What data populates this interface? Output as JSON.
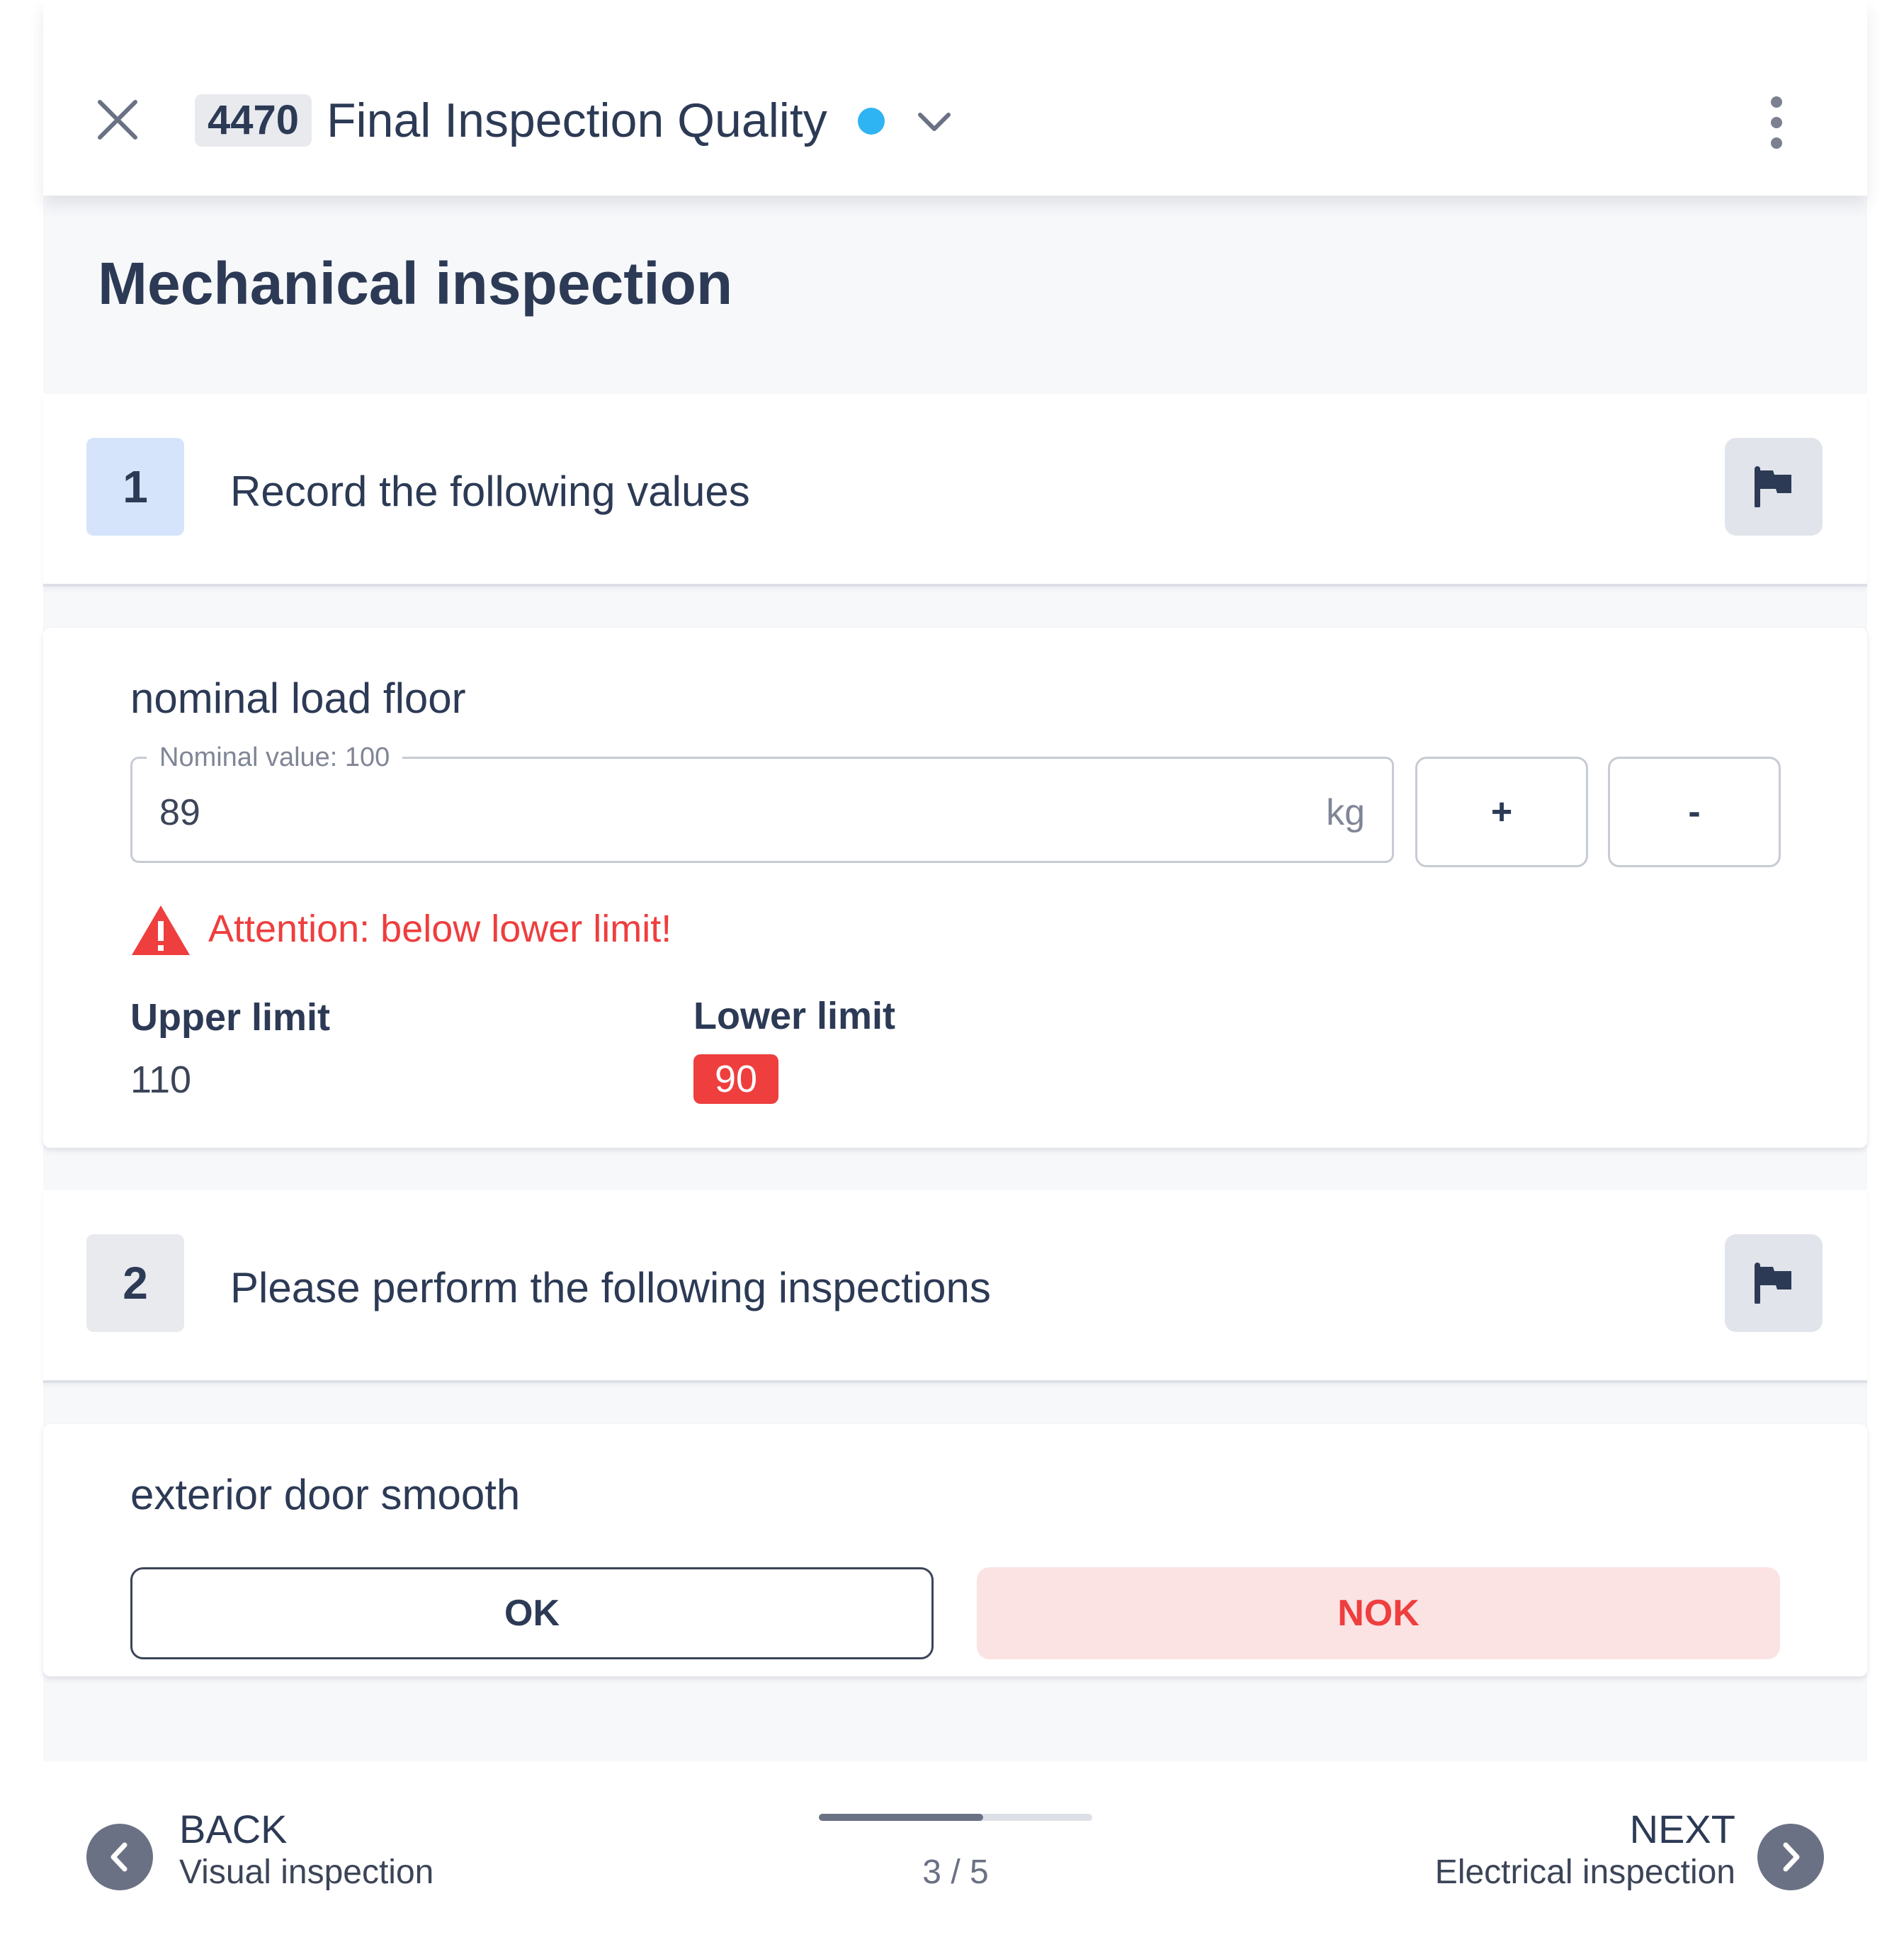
{
  "header": {
    "badge_id": "4470",
    "title": "Final Inspection Quality",
    "status_color": "#2fb4f3"
  },
  "section": {
    "title": "Mechanical inspection"
  },
  "steps": [
    {
      "number": "1",
      "text": "Record the following values",
      "state": "active"
    },
    {
      "number": "2",
      "text": "Please perform the following inspections",
      "state": "idle"
    }
  ],
  "measurement": {
    "label": "nominal load floor",
    "legend": "Nominal value: 100",
    "value": "89",
    "unit": "kg",
    "increment_label": "+",
    "decrement_label": "-",
    "warning": "Attention: below lower limit!",
    "upper_label": "Upper limit",
    "upper_value": "110",
    "lower_label": "Lower limit",
    "lower_value": "90"
  },
  "check": {
    "label": "exterior door smooth",
    "ok_label": "OK",
    "nok_label": "NOK",
    "selected": "NOK"
  },
  "footer": {
    "back_label": "BACK",
    "back_sub": "Visual inspection",
    "next_label": "NEXT",
    "next_sub": "Electrical inspection",
    "progress_text": "3 / 5",
    "progress_fraction": 0.6
  },
  "colors": {
    "primary_text": "#2c3a55",
    "error": "#ee3e3e",
    "error_soft": "#fbe2e3",
    "step_active": "#d6e4fb"
  }
}
